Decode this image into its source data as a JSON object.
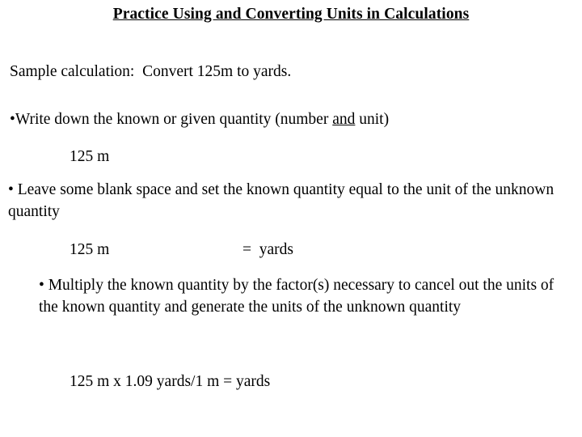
{
  "slide": {
    "title": "Practice Using and Converting Units in Calculations",
    "sample_calculation": "Sample calculation:  Convert 125m to yards.",
    "steps": [
      {
        "bullet": "•",
        "text_before": "Write down the known or given quantity (number ",
        "emphasis": "and",
        "text_after": " unit)"
      },
      {
        "bullet": "•",
        "text": "Leave some blank space and set the known quantity equal to the unit of the unknown quantity"
      },
      {
        "bullet": "•",
        "text": "Multiply the known quantity by the factor(s) necessary to cancel out the units of the known quantity and generate the units of the unknown quantity"
      }
    ],
    "work": {
      "known_quantity": "125 m",
      "equation_left": "125 m",
      "equation_right": "=  yards",
      "final_setup": "125 m x 1.09 yards/1 m = yards"
    },
    "colors": {
      "background": "#ffffff",
      "text": "#000000"
    }
  }
}
